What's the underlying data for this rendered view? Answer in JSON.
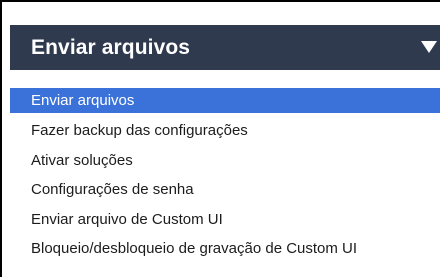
{
  "dropdown": {
    "selected_label": "Enviar arquivos",
    "caret_icon": "caret-down-icon",
    "header_color": "#2f3a4f",
    "highlight_color": "#3b72d9"
  },
  "options": [
    {
      "label": "Enviar arquivos",
      "selected": true
    },
    {
      "label": "Fazer backup das configurações",
      "selected": false
    },
    {
      "label": "Ativar soluções",
      "selected": false
    },
    {
      "label": "Configurações de senha",
      "selected": false
    },
    {
      "label": "Enviar arquivo de Custom UI",
      "selected": false
    },
    {
      "label": "Bloqueio/desbloqueio de gravação de Custom UI",
      "selected": false
    }
  ]
}
